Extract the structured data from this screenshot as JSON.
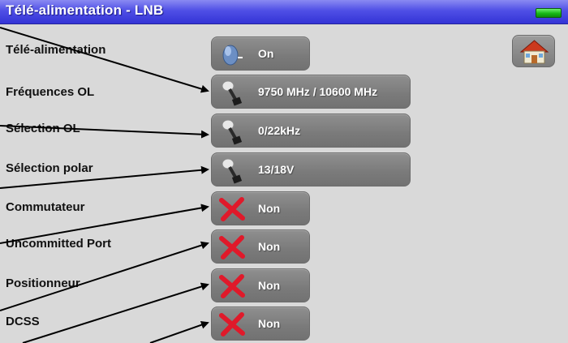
{
  "window": {
    "title": "Télé-alimentation - LNB"
  },
  "icons": {
    "home": "home-icon",
    "battery": "battery-icon",
    "satellite_dish": "satellite-dish-icon",
    "toggle_switch": "toggle-switch-icon",
    "disabled": "red-x-icon"
  },
  "colors": {
    "titlebar": "#3c3ce0",
    "button": "#808080",
    "button_text": "#ffffff",
    "background": "#d9d9d9",
    "battery": "#22c022",
    "disabled_x": "#e0192a"
  },
  "rows": [
    {
      "label": "Télé-alimentation",
      "value": "On"
    },
    {
      "label": "Fréquences OL",
      "value": "9750 MHz / 10600 MHz"
    },
    {
      "label": "Sélection OL",
      "value": "0/22kHz"
    },
    {
      "label": "Sélection polar",
      "value": "13/18V"
    },
    {
      "label": "Commutateur",
      "value": "Non"
    },
    {
      "label": "Uncommitted Port",
      "value": "Non"
    },
    {
      "label": "Positionneur",
      "value": "Non"
    },
    {
      "label": "DCSS",
      "value": "Non"
    }
  ]
}
